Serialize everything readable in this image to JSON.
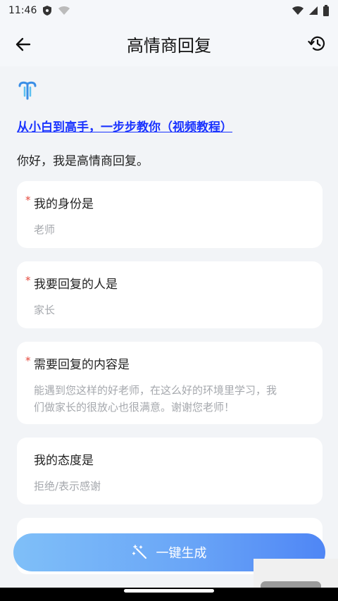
{
  "status_bar": {
    "time": "11:46"
  },
  "app_bar": {
    "title": "高情商回复"
  },
  "intro": {
    "tutorial_link": "从小白到高手，一步步教你（视频教程）",
    "greeting": "你好，我是高情商回复。"
  },
  "fields": [
    {
      "label": "我的身份是",
      "required_mark": "*",
      "value": "老师"
    },
    {
      "label": "我要回复的人是",
      "required_mark": "*",
      "value": "家长"
    },
    {
      "label": "需要回复的内容是",
      "required_mark": "*",
      "value_line1": "能遇到您这样的好老师，在这么好的环境里学习，我",
      "value_line2": "们做家长的很放心也很满意。谢谢您老师！"
    },
    {
      "label": "我的态度是",
      "value": "拒绝/表示感谢"
    }
  ],
  "generate_button": {
    "label": "一键生成"
  },
  "icons": {
    "back": "arrow-left-icon",
    "history": "history-icon",
    "logo": "app-logo-icon",
    "generate": "magic-wand-icon"
  },
  "colors": {
    "link": "#1a33ff",
    "required": "#e5483c",
    "button_start": "#7fbff8",
    "button_end": "#4f86f5"
  }
}
